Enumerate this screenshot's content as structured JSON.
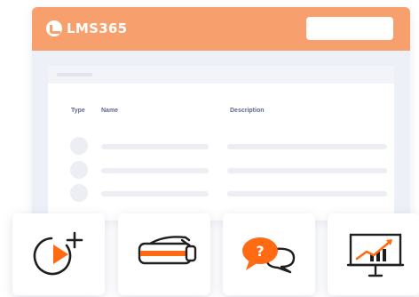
{
  "app": {
    "logo_text": "LMS365"
  },
  "table": {
    "headers": {
      "type": "Type",
      "name": "Name",
      "description": "Description"
    }
  },
  "cards": [
    {
      "icon": "video-add-icon"
    },
    {
      "icon": "vr-headset-icon"
    },
    {
      "icon": "quiz-chat-icon",
      "glyph": "?"
    },
    {
      "icon": "presentation-chart-icon"
    }
  ],
  "colors": {
    "brand_orange": "#f7a06d",
    "accent_orange": "#ff6a13",
    "dark_stroke": "#1f1f1f",
    "window_bg": "#eef0f8"
  }
}
